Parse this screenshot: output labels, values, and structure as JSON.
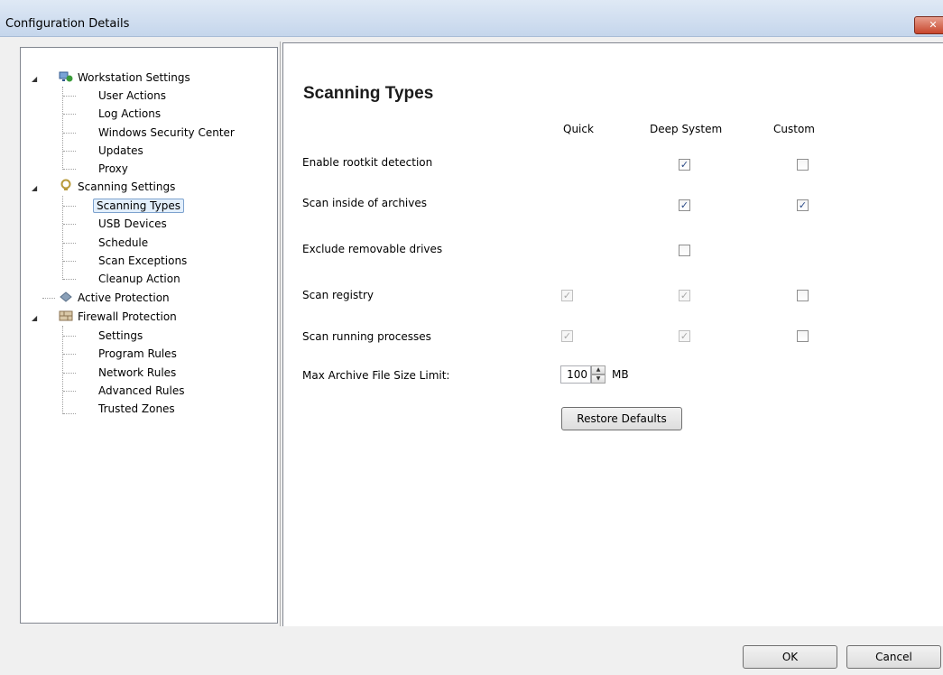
{
  "window": {
    "title": "Configuration Details",
    "close_label": "✕"
  },
  "tree": {
    "groups": [
      {
        "label": "Workstation Settings",
        "children": [
          "User Actions",
          "Log Actions",
          "Windows Security Center",
          "Updates",
          "Proxy"
        ]
      },
      {
        "label": "Scanning Settings",
        "children": [
          "Scanning Types",
          "USB Devices",
          "Schedule",
          "Scan Exceptions",
          "Cleanup Action"
        ]
      },
      {
        "label": "Active Protection",
        "children": []
      },
      {
        "label": "Firewall Protection",
        "children": [
          "Settings",
          "Program Rules",
          "Network Rules",
          "Advanced Rules",
          "Trusted Zones"
        ]
      }
    ],
    "selected": "Scanning Types"
  },
  "content": {
    "heading": "Scanning Types",
    "columns": [
      "Quick",
      "Deep System",
      "Custom"
    ],
    "rows": [
      {
        "label": "Enable rootkit detection",
        "quick": null,
        "deep": {
          "checked": true,
          "enabled": true
        },
        "custom": {
          "checked": false,
          "enabled": true
        }
      },
      {
        "label": "Scan inside of archives",
        "quick": null,
        "deep": {
          "checked": true,
          "enabled": true
        },
        "custom": {
          "checked": true,
          "enabled": true
        }
      },
      {
        "label": "Exclude removable drives",
        "quick": null,
        "deep": {
          "checked": false,
          "enabled": true
        },
        "custom": null
      },
      {
        "label": "Scan registry",
        "quick": {
          "checked": true,
          "enabled": false
        },
        "deep": {
          "checked": true,
          "enabled": false
        },
        "custom": {
          "checked": false,
          "enabled": true
        }
      },
      {
        "label": "Scan running processes",
        "quick": {
          "checked": true,
          "enabled": false
        },
        "deep": {
          "checked": true,
          "enabled": false
        },
        "custom": {
          "checked": false,
          "enabled": true
        }
      }
    ],
    "archive_limit": {
      "label": "Max Archive File Size Limit:",
      "value": "100",
      "unit": "MB"
    },
    "restore_label": "Restore Defaults"
  },
  "footer": {
    "ok_label": "OK",
    "cancel_label": "Cancel"
  }
}
